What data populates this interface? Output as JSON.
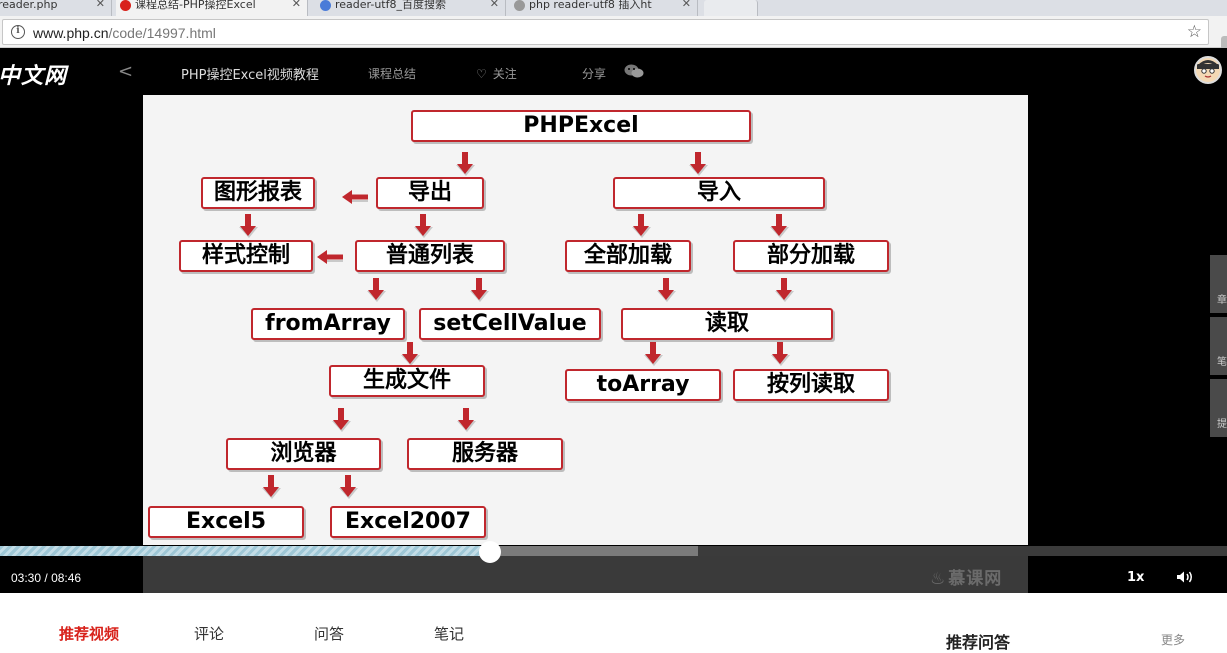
{
  "browser": {
    "tabs": [
      {
        "label": "reader.php",
        "active": false
      },
      {
        "label": "课程总结-PHP操控Excel",
        "active": true
      },
      {
        "label": "reader-utf8_百度搜索",
        "active": false
      },
      {
        "label": "php reader-utf8 插入ht",
        "active": false
      }
    ],
    "url_host": "www.php.cn",
    "url_path": "/code/14997.html"
  },
  "header": {
    "logo": "中文网",
    "course_title": "PHP操控Excel视频教程",
    "summary_link": "课程总结",
    "follow_label": "关注",
    "share_label": "分享"
  },
  "player": {
    "current_time": "03:30",
    "duration": "08:46",
    "time_separator": "/",
    "played_fraction": 0.399,
    "buffered_fraction": 0.569,
    "speed_label": "1x",
    "watermark": "慕课网",
    "side_tabs": [
      "章",
      "笔",
      "提"
    ]
  },
  "diagram": {
    "nodes": {
      "root": "PHPExcel",
      "export": "导出",
      "import": "导入",
      "chart_report": "图形报表",
      "normal_list": "普通列表",
      "style_control": "样式控制",
      "full_load": "全部加载",
      "partial_load": "部分加载",
      "from_array": "fromArray",
      "set_cell_value": "setCellValue",
      "read": "读取",
      "generate_file": "生成文件",
      "to_array": "toArray",
      "read_by_column": "按列读取",
      "browser": "浏览器",
      "server": "服务器",
      "excel5": "Excel5",
      "excel2007": "Excel2007"
    },
    "edges": [
      [
        "root",
        "export"
      ],
      [
        "root",
        "import"
      ],
      [
        "export",
        "chart_report"
      ],
      [
        "export",
        "normal_list"
      ],
      [
        "chart_report",
        "style_control"
      ],
      [
        "normal_list",
        "style_control"
      ],
      [
        "import",
        "full_load"
      ],
      [
        "import",
        "partial_load"
      ],
      [
        "normal_list",
        "from_array"
      ],
      [
        "normal_list",
        "set_cell_value"
      ],
      [
        "full_load",
        "read"
      ],
      [
        "partial_load",
        "read"
      ],
      [
        "set_cell_value",
        "generate_file"
      ],
      [
        "read",
        "to_array"
      ],
      [
        "read",
        "read_by_column"
      ],
      [
        "generate_file",
        "browser"
      ],
      [
        "generate_file",
        "server"
      ],
      [
        "browser",
        "excel5"
      ],
      [
        "browser",
        "excel2007"
      ]
    ],
    "colors": {
      "border": "#c0272d",
      "arrow": "#c0272d"
    }
  },
  "bottom_tabs": [
    {
      "label": "推荐视频",
      "active": true
    },
    {
      "label": "评论",
      "active": false
    },
    {
      "label": "问答",
      "active": false
    },
    {
      "label": "笔记",
      "active": false
    }
  ],
  "sidebar": {
    "title": "推荐问答",
    "more_label": "更多"
  }
}
